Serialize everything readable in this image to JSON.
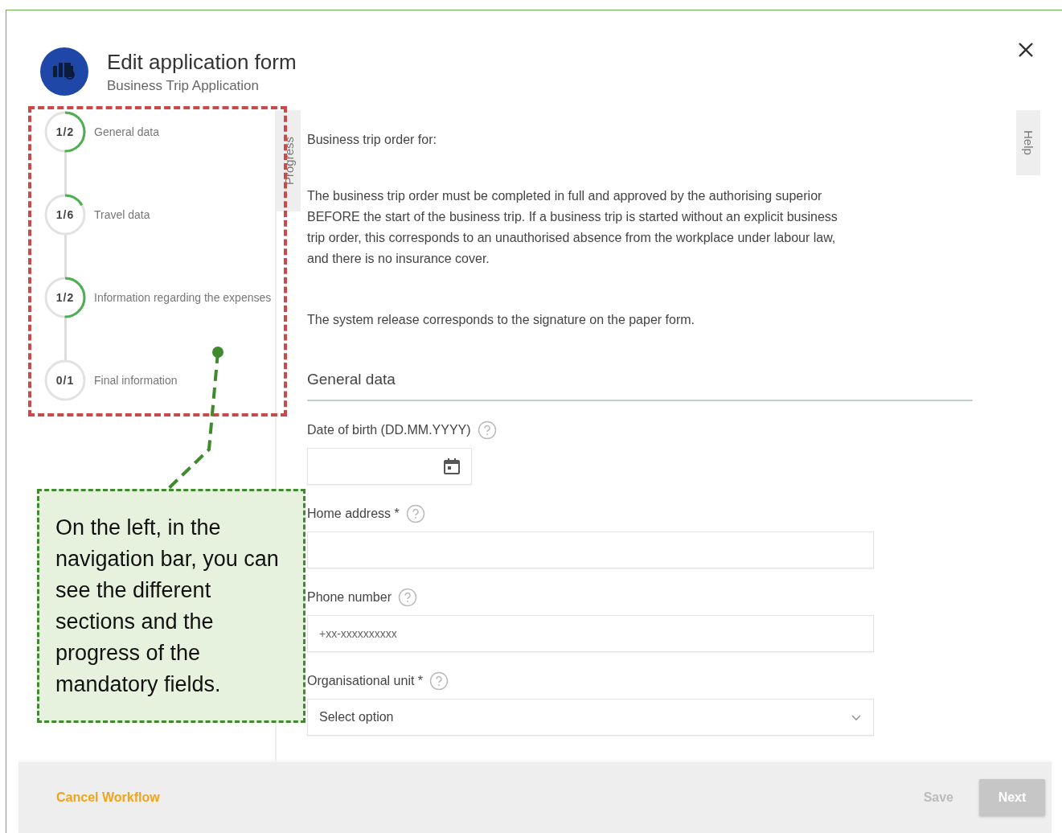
{
  "dialog": {
    "title": "Edit application form",
    "subtitle": "Business Trip Application"
  },
  "steps": [
    {
      "count": "1/2",
      "label": "General data"
    },
    {
      "count": "1/6",
      "label": "Travel data"
    },
    {
      "count": "1/2",
      "label": "Information regarding the expenses"
    },
    {
      "count": "0/1",
      "label": "Final information"
    }
  ],
  "side_tabs": {
    "progress": "Progress",
    "help": "Help"
  },
  "intro": {
    "heading": "Business trip order for:",
    "paragraphs": [
      "The business trip order must be completed in full and approved by the authorising superior BEFORE the start of the business trip. If a business trip is started without an explicit business trip order, this corresponds to an unauthorised absence from the workplace under labour law, and there is no insurance cover.",
      "The system release corresponds to the signature on the paper form."
    ]
  },
  "section": {
    "title": "General data"
  },
  "fields": [
    {
      "kind": "date",
      "label": "Date of birth (DD.MM.YYYY)"
    },
    {
      "kind": "text",
      "label": "Home address *"
    },
    {
      "kind": "text",
      "label": "Phone number",
      "placeholder": "+xx-xxxxxxxxxx"
    },
    {
      "kind": "select",
      "label": "Organisational unit *",
      "placeholder": "Select option"
    }
  ],
  "footer": {
    "cancel": "Cancel Workflow",
    "buttons": [
      {
        "label": "Save",
        "kind": "text",
        "disabled": true
      },
      {
        "label": "Next",
        "kind": "filled",
        "disabled": true
      }
    ]
  },
  "callout": {
    "text": "On the left, in the navigation bar, you can see the different sections and the progress of the mandatory fields."
  }
}
